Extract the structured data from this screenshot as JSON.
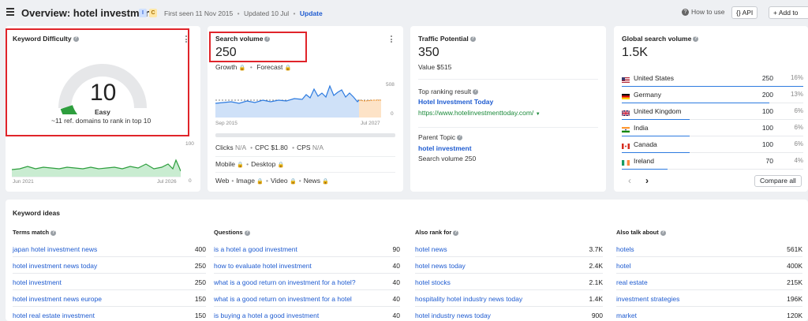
{
  "header": {
    "title": "Overview: hotel investment",
    "badge_i": "I",
    "badge_c": "C",
    "first_seen": "First seen 11 Nov 2015",
    "updated": "Updated 10 Jul",
    "update_label": "Update",
    "how_to_use": "How to use",
    "api_label": "API",
    "add_to_label": "Add to"
  },
  "kd": {
    "title": "Keyword Difficulty",
    "value": "10",
    "level": "Easy",
    "caption": "~11 ref. domains to rank in top 10",
    "chart_max": "100",
    "chart_min": "0",
    "x_start": "Jun 2021",
    "x_end": "Jul 2026",
    "gauge_fraction": 0.1
  },
  "sv": {
    "title": "Search volume",
    "value": "250",
    "growth": "Growth",
    "forecast": "Forecast",
    "y_max": "508",
    "y_min": "0",
    "x_start": "Sep 2015",
    "x_end": "Jul 2027",
    "clicks": "Clicks",
    "clicks_val": "N/A",
    "cpc": "CPC $1.80",
    "cps": "CPS",
    "cps_val": "N/A",
    "mobile": "Mobile",
    "desktop": "Desktop",
    "web": "Web",
    "image": "Image",
    "video": "Video",
    "news": "News"
  },
  "tp": {
    "title": "Traffic Potential",
    "value": "350",
    "value_usd": "Value $515",
    "top_result_label": "Top ranking result",
    "top_result_title": "Hotel Investment Today",
    "top_result_url": "https://www.hotelinvestmenttoday.com/",
    "parent_topic_label": "Parent Topic",
    "parent_topic": "hotel investment",
    "parent_volume": "Search volume 250"
  },
  "gsv": {
    "title": "Global search volume",
    "value": "1.5K",
    "compare_label": "Compare all",
    "countries": [
      {
        "name": "United States",
        "value": "250",
        "pct": "16%",
        "share": 0.16
      },
      {
        "name": "Germany",
        "value": "200",
        "pct": "13%",
        "share": 0.13
      },
      {
        "name": "United Kingdom",
        "value": "100",
        "pct": "6%",
        "share": 0.06
      },
      {
        "name": "India",
        "value": "100",
        "pct": "6%",
        "share": 0.06
      },
      {
        "name": "Canada",
        "value": "100",
        "pct": "6%",
        "share": 0.06
      },
      {
        "name": "Ireland",
        "value": "70",
        "pct": "4%",
        "share": 0.04
      }
    ]
  },
  "ideas": {
    "title": "Keyword ideas",
    "columns": [
      {
        "header": "Terms match",
        "rows": [
          {
            "kw": "japan hotel investment news",
            "n": "400"
          },
          {
            "kw": "hotel investment news today",
            "n": "250"
          },
          {
            "kw": "hotel investment",
            "n": "250"
          },
          {
            "kw": "hotel investment news europe",
            "n": "150"
          },
          {
            "kw": "hotel real estate investment",
            "n": "150"
          }
        ]
      },
      {
        "header": "Questions",
        "rows": [
          {
            "kw": "is a hotel a good investment",
            "n": "90"
          },
          {
            "kw": "how to evaluate hotel investment",
            "n": "40"
          },
          {
            "kw": "what is a good return on investment for a hotel?",
            "n": "40"
          },
          {
            "kw": "what is a good return on investment for a hotel",
            "n": "40"
          },
          {
            "kw": "is buying a hotel a good investment",
            "n": "40"
          }
        ]
      },
      {
        "header": "Also rank for",
        "rows": [
          {
            "kw": "hotel news",
            "n": "3.7K"
          },
          {
            "kw": "hotel news today",
            "n": "2.4K"
          },
          {
            "kw": "hotel stocks",
            "n": "2.1K"
          },
          {
            "kw": "hospitality hotel industry news today",
            "n": "1.4K"
          },
          {
            "kw": "hotel industry news today",
            "n": "900"
          }
        ]
      },
      {
        "header": "Also talk about",
        "rows": [
          {
            "kw": "hotels",
            "n": "561K"
          },
          {
            "kw": "hotel",
            "n": "400K"
          },
          {
            "kw": "real estate",
            "n": "215K"
          },
          {
            "kw": "investment strategies",
            "n": "196K"
          },
          {
            "kw": "market",
            "n": "120K"
          }
        ]
      }
    ]
  },
  "colors": {
    "accent": "#1e5bd0",
    "green": "#1b8a3a",
    "highlight": "#e0242a"
  }
}
